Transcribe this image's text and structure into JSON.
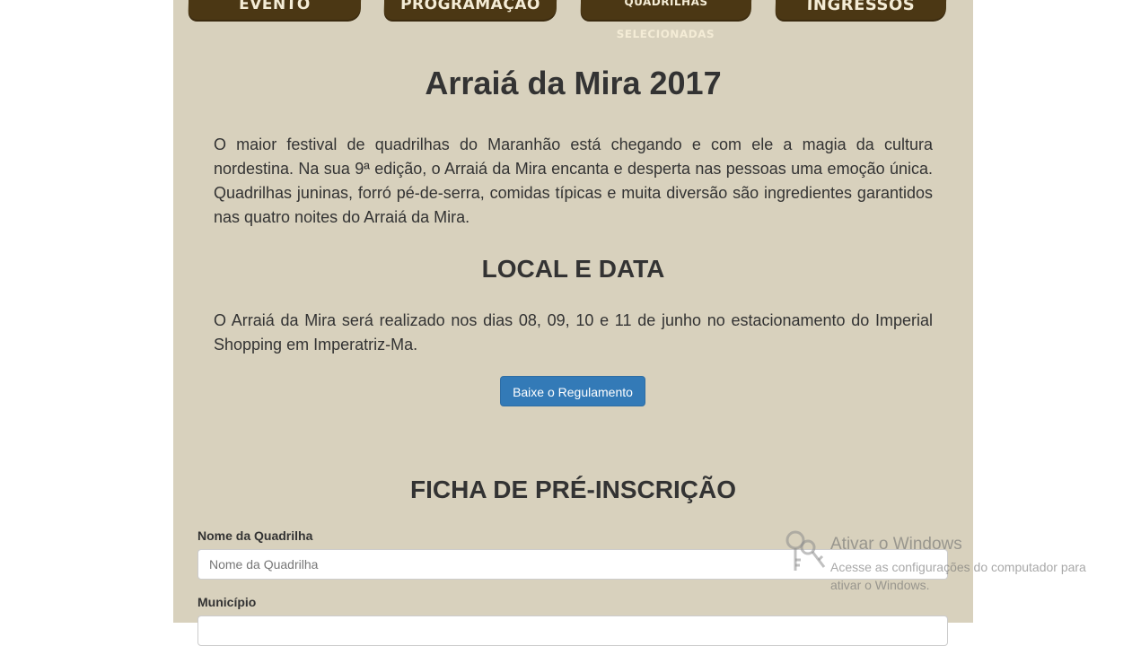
{
  "nav": {
    "items": [
      {
        "label": "EVENTO"
      },
      {
        "label": "PROGRAMAÇÃO"
      },
      {
        "label": "QUADRILHAS SELECIONADAS"
      },
      {
        "label": "INGRESSOS"
      }
    ]
  },
  "main": {
    "title": "Arraiá da Mira 2017",
    "intro": "O maior festival de quadrilhas do Maranhão está chegando e com ele a magia da cultura nordestina. Na sua 9ª edição, o Arraiá da Mira encanta e desperta nas pessoas uma emoção única. Quadrilhas juninas, forró pé-de-serra, comidas típicas e muita diversão são ingredientes garantidos nas quatro noites do Arraiá da Mira.",
    "local_heading": "LOCAL E DATA",
    "local_text": "O Arraiá da Mira será realizado nos dias 08, 09, 10 e 11 de junho no estacionamento do Imperial Shopping em Imperatriz-Ma.",
    "download_button": "Baixe o Regulamento"
  },
  "form": {
    "heading": "FICHA DE PRÉ-INSCRIÇÃO",
    "fields": [
      {
        "label": "Nome da Quadrilha",
        "placeholder": "Nome da Quadrilha",
        "value": ""
      },
      {
        "label": "Município",
        "placeholder": "",
        "value": ""
      }
    ]
  },
  "watermark": {
    "title": "Ativar o Windows",
    "subtitle": "Acesse as configurações do computador para ativar o Windows.",
    "icon": "key-icon"
  },
  "colors": {
    "page_background": "#d8d1bd",
    "nav_background": "#4b3714",
    "button_primary": "#337ab7"
  }
}
